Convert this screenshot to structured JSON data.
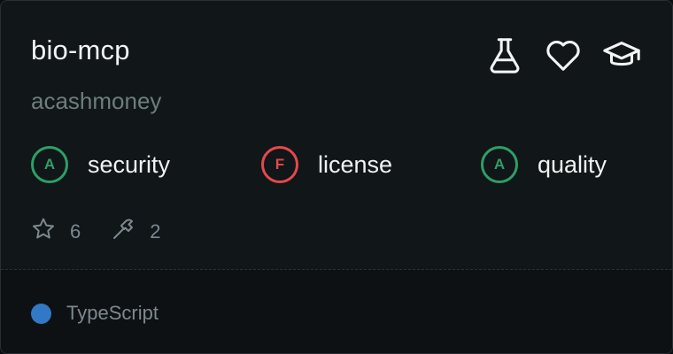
{
  "repo": {
    "name": "bio-mcp",
    "owner": "acashmoney"
  },
  "header_icons": [
    "flask-icon",
    "heart-icon",
    "graduation-cap-icon"
  ],
  "scores": [
    {
      "grade": "A",
      "label": "security",
      "status": "good"
    },
    {
      "grade": "F",
      "label": "license",
      "status": "bad"
    },
    {
      "grade": "A",
      "label": "quality",
      "status": "good"
    }
  ],
  "stats": {
    "stars": "6",
    "tools": "2"
  },
  "language": {
    "name": "TypeScript",
    "color": "#3178c6"
  },
  "colors": {
    "good": "#2e9e68",
    "bad": "#e5484d",
    "muted": "#6b7f7a"
  }
}
